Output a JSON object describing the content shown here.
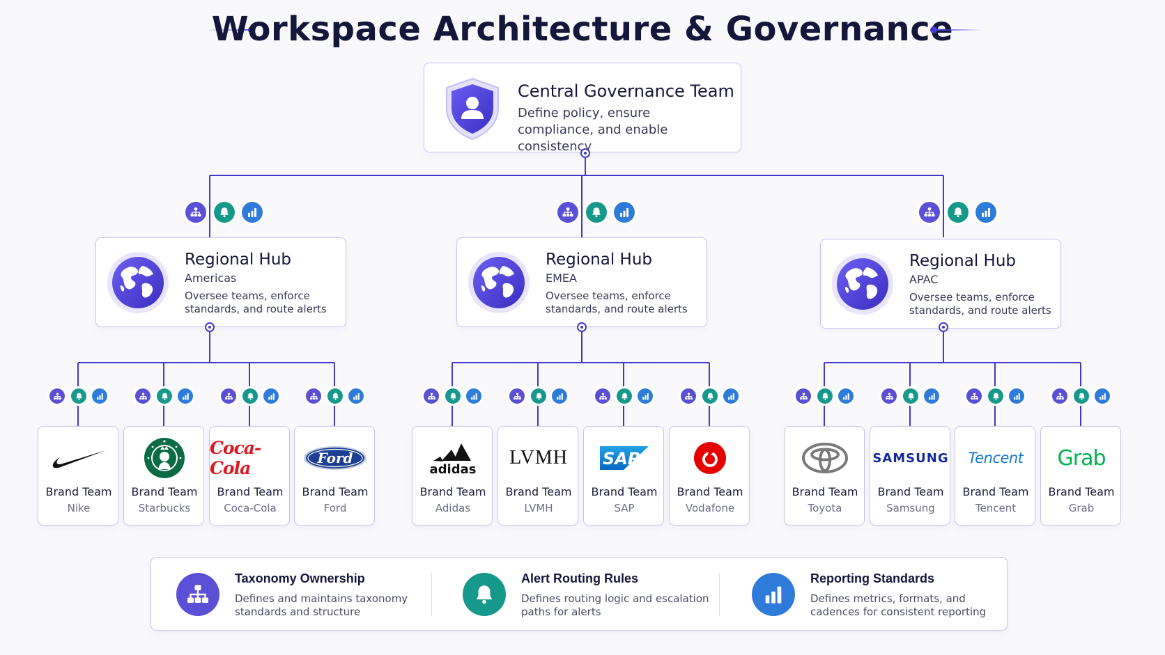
{
  "title": "Workspace Architecture & Governance",
  "colors": {
    "line": "#4338ca",
    "border": "#c7c4ee",
    "purple": "#5b4fd6",
    "teal": "#16998a",
    "blue": "#2f7bd9",
    "title": "#14163a"
  },
  "central": {
    "icon": "shield-user-icon",
    "title": "Central Governance Team",
    "description": "Define policy, ensure compliance, and enable consistency"
  },
  "badge_icons": [
    "hierarchy-icon",
    "bell-icon",
    "bar-chart-icon"
  ],
  "hubs": [
    {
      "title": "Regional Hub",
      "region": "Americas",
      "description": "Oversee teams, enforce standards, and route alerts",
      "brands": [
        {
          "title": "Brand Team",
          "name": "Nike",
          "logo": "nike-swoosh-logo"
        },
        {
          "title": "Brand Team",
          "name": "Starbucks",
          "logo": "starbucks-siren-logo"
        },
        {
          "title": "Brand Team",
          "name": "Coca-Cola",
          "logo": "coca-cola-script-logo",
          "logo_text": "Coca-Cola"
        },
        {
          "title": "Brand Team",
          "name": "Ford",
          "logo": "ford-oval-logo",
          "logo_text": "Ford"
        }
      ]
    },
    {
      "title": "Regional Hub",
      "region": "EMEA",
      "description": "Oversee teams, enforce standards, and route alerts",
      "brands": [
        {
          "title": "Brand Team",
          "name": "Adidas",
          "logo": "adidas-stripes-logo",
          "logo_text": "adidas"
        },
        {
          "title": "Brand Team",
          "name": "LVMH",
          "logo": "lvmh-wordmark-logo",
          "logo_text": "LVMH"
        },
        {
          "title": "Brand Team",
          "name": "SAP",
          "logo": "sap-logo",
          "logo_text": "SAP"
        },
        {
          "title": "Brand Team",
          "name": "Vodafone",
          "logo": "vodafone-speechmark-logo"
        }
      ]
    },
    {
      "title": "Regional Hub",
      "region": "APAC",
      "description": "Oversee teams, enforce standards, and route alerts",
      "brands": [
        {
          "title": "Brand Team",
          "name": "Toyota",
          "logo": "toyota-ellipses-logo"
        },
        {
          "title": "Brand Team",
          "name": "Samsung",
          "logo": "samsung-wordmark-logo",
          "logo_text": "SAMSUNG"
        },
        {
          "title": "Brand Team",
          "name": "Tencent",
          "logo": "tencent-wordmark-logo",
          "logo_text": "Tencent"
        },
        {
          "title": "Brand Team",
          "name": "Grab",
          "logo": "grab-wordmark-logo",
          "logo_text": "Grab"
        }
      ]
    }
  ],
  "legend": [
    {
      "icon": "hierarchy-icon",
      "color": "#5b4fd6",
      "title": "Taxonomy Ownership",
      "description": "Defines and maintains taxonomy standards and structure"
    },
    {
      "icon": "bell-icon",
      "color": "#16998a",
      "title": "Alert Routing Rules",
      "description": "Defines routing logic and escalation paths for alerts"
    },
    {
      "icon": "bar-chart-icon",
      "color": "#2f7bd9",
      "title": "Reporting Standards",
      "description": "Defines metrics, formats, and cadences for consistent reporting"
    }
  ]
}
